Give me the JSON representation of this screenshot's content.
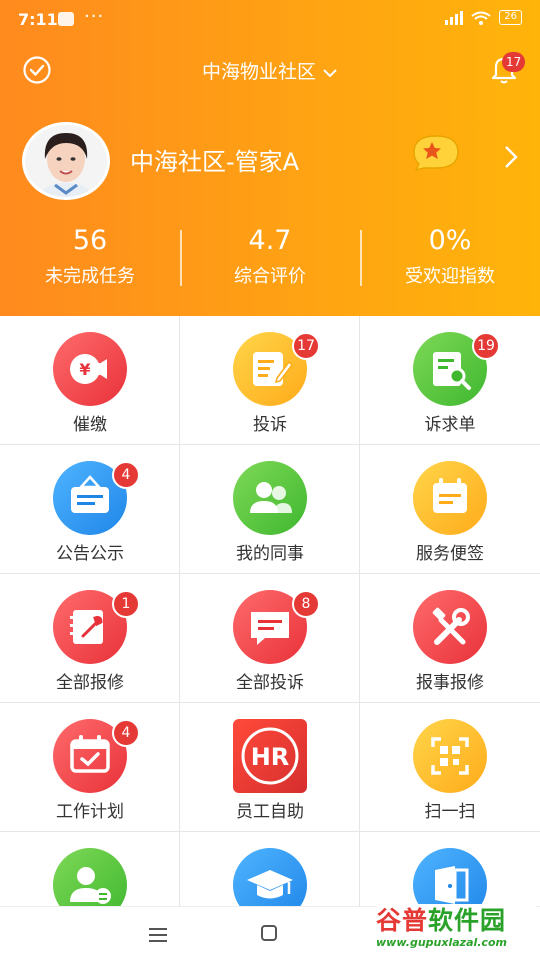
{
  "status_bar": {
    "time": "7:11",
    "dots": "···",
    "battery": "26"
  },
  "header": {
    "community_name": "中海物业社区",
    "notification_count": "17",
    "user_name": "中海社区-管家A"
  },
  "stats": [
    {
      "value": "56",
      "label": "未完成任务"
    },
    {
      "value": "4.7",
      "label": "综合评价"
    },
    {
      "value": "0%",
      "label": "受欢迎指数"
    }
  ],
  "colors": {
    "header_start": "#ff8a1e",
    "header_end": "#ffb40a",
    "badge": "#e53935"
  },
  "grid": [
    {
      "label": "催缴",
      "icon": "yuan-megaphone-icon",
      "badge": ""
    },
    {
      "label": "投诉",
      "icon": "note-pen-icon",
      "badge": "17"
    },
    {
      "label": "诉求单",
      "icon": "document-search-icon",
      "badge": "19"
    },
    {
      "label": "公告公示",
      "icon": "notice-board-icon",
      "badge": "4"
    },
    {
      "label": "我的同事",
      "icon": "colleagues-icon",
      "badge": ""
    },
    {
      "label": "服务便签",
      "icon": "calendar-note-icon",
      "badge": ""
    },
    {
      "label": "全部报修",
      "icon": "repair-book-icon",
      "badge": "1"
    },
    {
      "label": "全部投诉",
      "icon": "message-icon",
      "badge": "8"
    },
    {
      "label": "报事报修",
      "icon": "tools-icon",
      "badge": ""
    },
    {
      "label": "工作计划",
      "icon": "calendar-check-icon",
      "badge": "4"
    },
    {
      "label": "员工自助",
      "icon": "hr-logo-icon",
      "badge": ""
    },
    {
      "label": "扫一扫",
      "icon": "scan-icon",
      "badge": ""
    },
    {
      "label": "",
      "icon": "user-card-icon",
      "badge": ""
    },
    {
      "label": "",
      "icon": "graduation-cap-icon",
      "badge": ""
    },
    {
      "label": "",
      "icon": "door-icon",
      "badge": ""
    }
  ],
  "watermark": {
    "brand_a": "谷普",
    "brand_b": "软件园",
    "url": "www.gupuxlazal.com"
  }
}
